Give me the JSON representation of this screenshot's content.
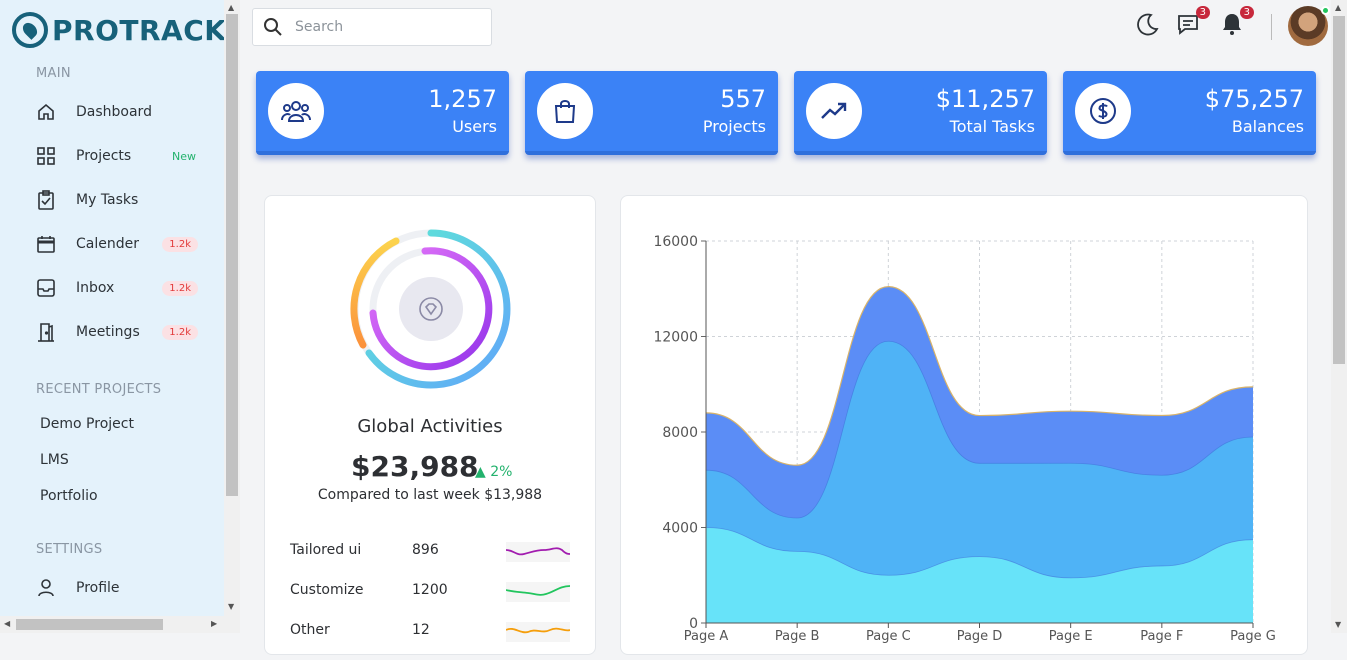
{
  "brand": {
    "name": "PROTRACK"
  },
  "sidebar": {
    "main_title": "MAIN",
    "items": [
      {
        "label": "Dashboard",
        "icon": "home-icon",
        "badge": ""
      },
      {
        "label": "Projects",
        "icon": "grid-icon",
        "badge": "New"
      },
      {
        "label": "My Tasks",
        "icon": "clipboard-check-icon",
        "badge": ""
      },
      {
        "label": "Calender",
        "icon": "calendar-icon",
        "badge": "1.2k"
      },
      {
        "label": "Inbox",
        "icon": "inbox-icon",
        "badge": "1.2k"
      },
      {
        "label": "Meetings",
        "icon": "door-icon",
        "badge": "1.2k"
      }
    ],
    "recent_title": "RECENT PROJECTS",
    "recent": [
      "Demo Project",
      "LMS",
      "Portfolio"
    ],
    "settings_title": "SETTINGS",
    "settings": [
      {
        "label": "Profile",
        "icon": "user-icon"
      }
    ]
  },
  "topbar": {
    "search_placeholder": "Search",
    "messages_count": "3",
    "notifications_count": "3"
  },
  "stats": [
    {
      "value": "1,257",
      "label": "Users",
      "icon": "users-icon"
    },
    {
      "value": "557",
      "label": "Projects",
      "icon": "bag-icon"
    },
    {
      "value": "$11,257",
      "label": "Total Tasks",
      "icon": "trending-up-icon"
    },
    {
      "value": "$75,257",
      "label": "Balances",
      "icon": "dollar-circle-icon"
    }
  ],
  "global": {
    "title": "Global Activities",
    "amount": "$23,988",
    "change": "2%",
    "compare": "Compared to last week $13,988",
    "rows": [
      {
        "name": "Tailored ui",
        "value": "896",
        "color": "#a21caf"
      },
      {
        "name": "Customize",
        "value": "1200",
        "color": "#22c55e"
      },
      {
        "name": "Other",
        "value": "12",
        "color": "#f59e0b"
      }
    ]
  },
  "chart_data": {
    "type": "area",
    "categories": [
      "Page A",
      "Page B",
      "Page C",
      "Page D",
      "Page E",
      "Page F",
      "Page G"
    ],
    "ylim": [
      0,
      16000
    ],
    "yticks": [
      "0",
      "4000",
      "8000",
      "12000",
      "16000"
    ],
    "series": [
      {
        "values": [
          4000,
          3000,
          2000,
          2780,
          1890,
          2390,
          3490
        ],
        "color": "#67e3f9"
      },
      {
        "values": [
          2400,
          1398,
          9800,
          3908,
          4800,
          3800,
          4300
        ],
        "color": "#4fb3f6"
      },
      {
        "values": [
          2400,
          2210,
          2290,
          2000,
          2181,
          2500,
          2100
        ],
        "color": "#5b8df6"
      }
    ]
  }
}
